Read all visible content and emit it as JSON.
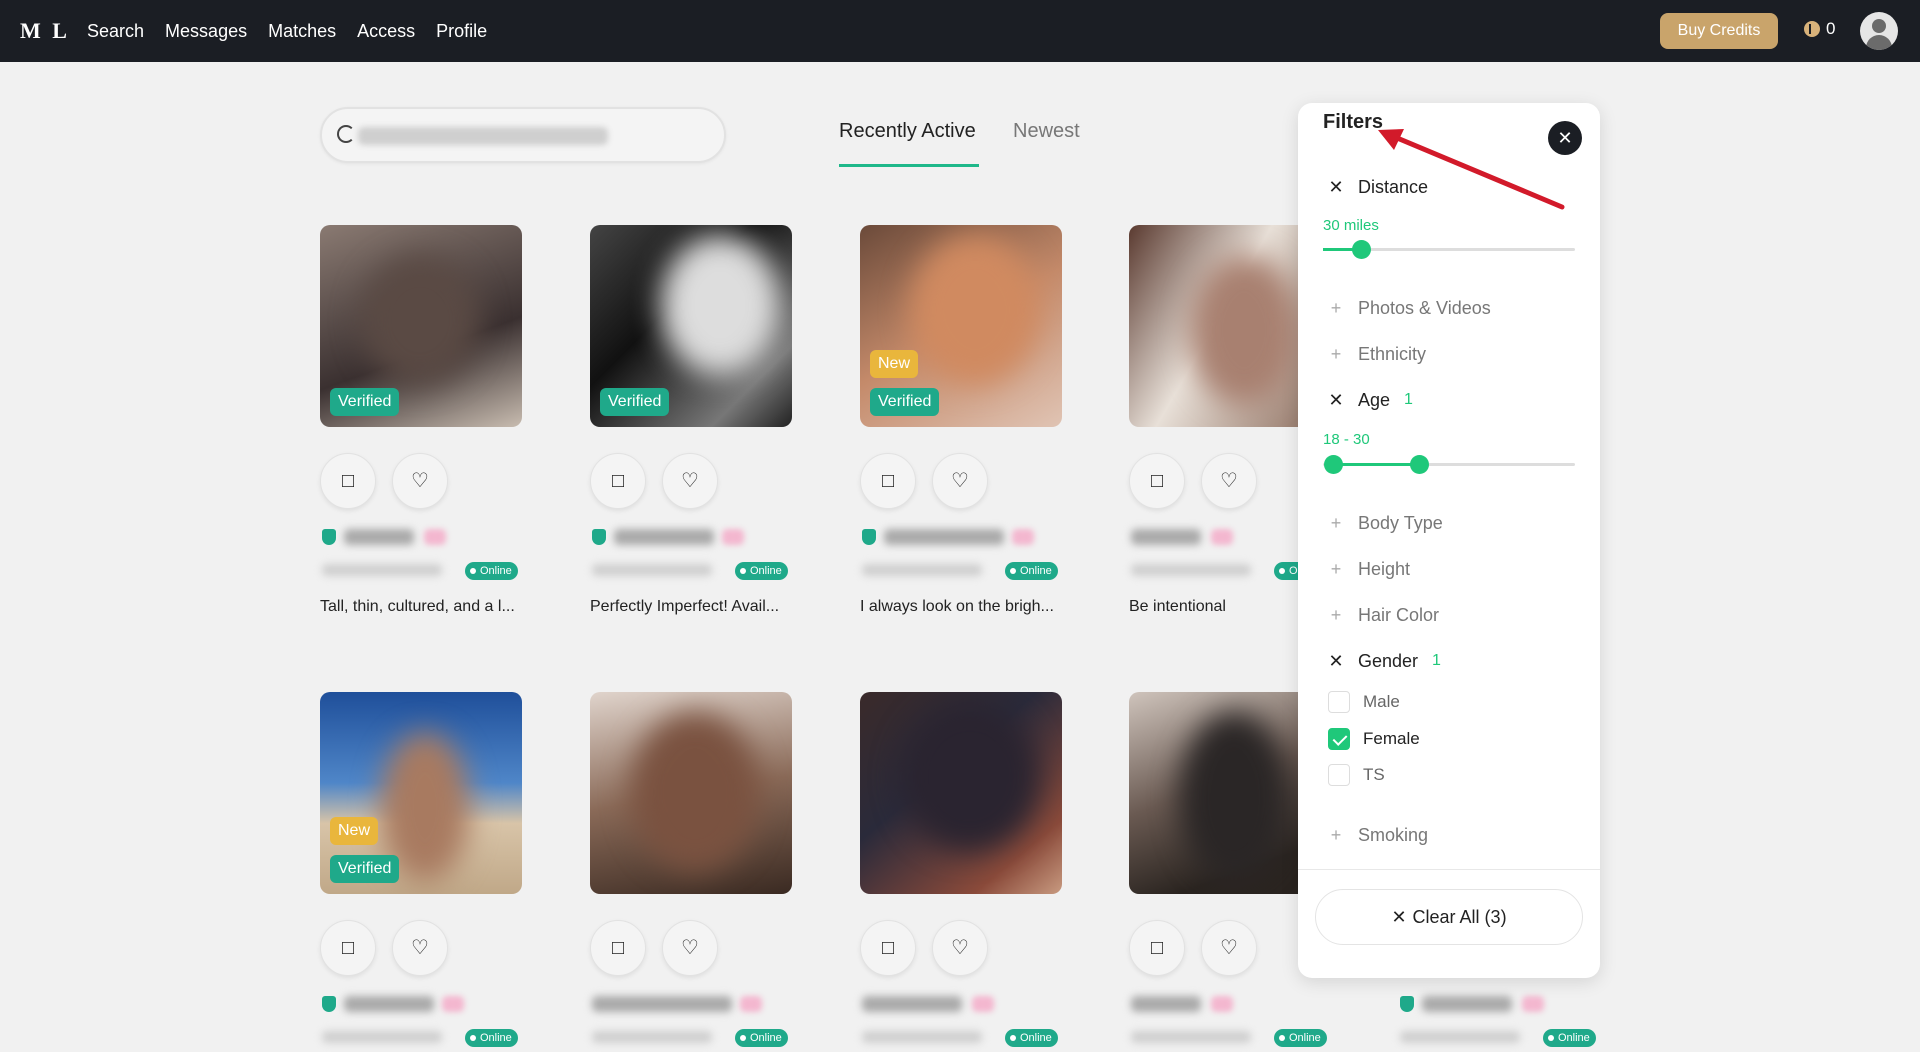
{
  "header": {
    "logo": "M L",
    "nav": [
      "Search",
      "Messages",
      "Matches",
      "Access",
      "Profile"
    ],
    "buy_credits": "Buy Credits",
    "credits": "0"
  },
  "search": {
    "placeholder": ""
  },
  "tabs": {
    "active": "Recently Active",
    "inactive": "Newest"
  },
  "badges": {
    "verified": "Verified",
    "new": "New",
    "online": "Online"
  },
  "profiles": [
    {
      "bio": "Tall, thin, cultured, and a l...",
      "verified": true,
      "new": false,
      "online": true
    },
    {
      "bio": "Perfectly Imperfect! Avail...",
      "verified": true,
      "new": false,
      "online": true
    },
    {
      "bio": "I always look on the brigh...",
      "verified": true,
      "new": true,
      "online": true
    },
    {
      "bio": "Be intentional",
      "verified": false,
      "new": false,
      "online": true
    },
    {
      "bio": "",
      "verified": true,
      "new": true,
      "online": true
    },
    {
      "bio": "",
      "verified": false,
      "new": false,
      "online": true
    },
    {
      "bio": "",
      "verified": false,
      "new": false,
      "online": true
    },
    {
      "bio": "",
      "verified": false,
      "new": false,
      "online": true
    }
  ],
  "filters": {
    "title": "Filters",
    "distance": {
      "label": "Distance",
      "value": "30 miles",
      "fraction": 0.15
    },
    "photos_videos": "Photos & Videos",
    "ethnicity": "Ethnicity",
    "age": {
      "label": "Age",
      "count": "1",
      "value": "18 - 30",
      "min_fraction": 0.04,
      "max_fraction": 0.38
    },
    "body_type": "Body Type",
    "height": "Height",
    "hair_color": "Hair Color",
    "gender": {
      "label": "Gender",
      "count": "1",
      "options": [
        {
          "label": "Male",
          "checked": false
        },
        {
          "label": "Female",
          "checked": true
        },
        {
          "label": "TS",
          "checked": false
        }
      ]
    },
    "smoking": "Smoking",
    "clear_all": "Clear All (3)"
  },
  "colors": {
    "accent": "#1fc87a",
    "verified": "#1fa98a",
    "new_badge": "#e9b63c",
    "buy_button": "#c9a46b",
    "topbar": "#1b1e24"
  }
}
